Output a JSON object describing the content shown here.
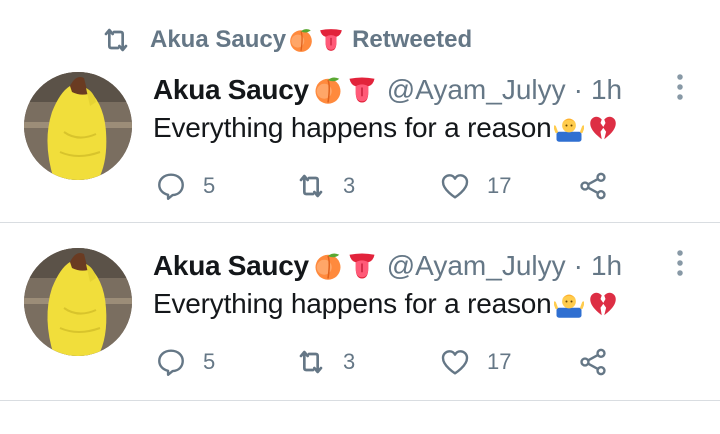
{
  "retweet_context": {
    "icon": "retweet-icon",
    "name": "Akua Saucy",
    "emojis": [
      "peach-emoji",
      "tongue-emoji"
    ],
    "label": "Retweeted"
  },
  "tweets": [
    {
      "author_name": "Akua Saucy",
      "author_emojis": [
        "peach-emoji",
        "tongue-emoji"
      ],
      "handle": "@Ayam_Julyy",
      "separator": "·",
      "time": "1h",
      "text": "Everything happens for a reason",
      "text_emojis": [
        "man-shrugging-emoji",
        "broken-heart-emoji"
      ],
      "replies": "5",
      "retweets": "3",
      "likes": "17"
    },
    {
      "author_name": "Akua Saucy",
      "author_emojis": [
        "peach-emoji",
        "tongue-emoji"
      ],
      "handle": "@Ayam_Julyy",
      "separator": "·",
      "time": "1h",
      "text": "Everything happens for a reason",
      "text_emojis": [
        "man-shrugging-emoji",
        "broken-heart-emoji"
      ],
      "replies": "5",
      "retweets": "3",
      "likes": "17"
    }
  ],
  "colors": {
    "secondary_text": "#657786",
    "primary_text": "#14171a",
    "divider": "#d9dde1",
    "background": "#ffffff"
  }
}
